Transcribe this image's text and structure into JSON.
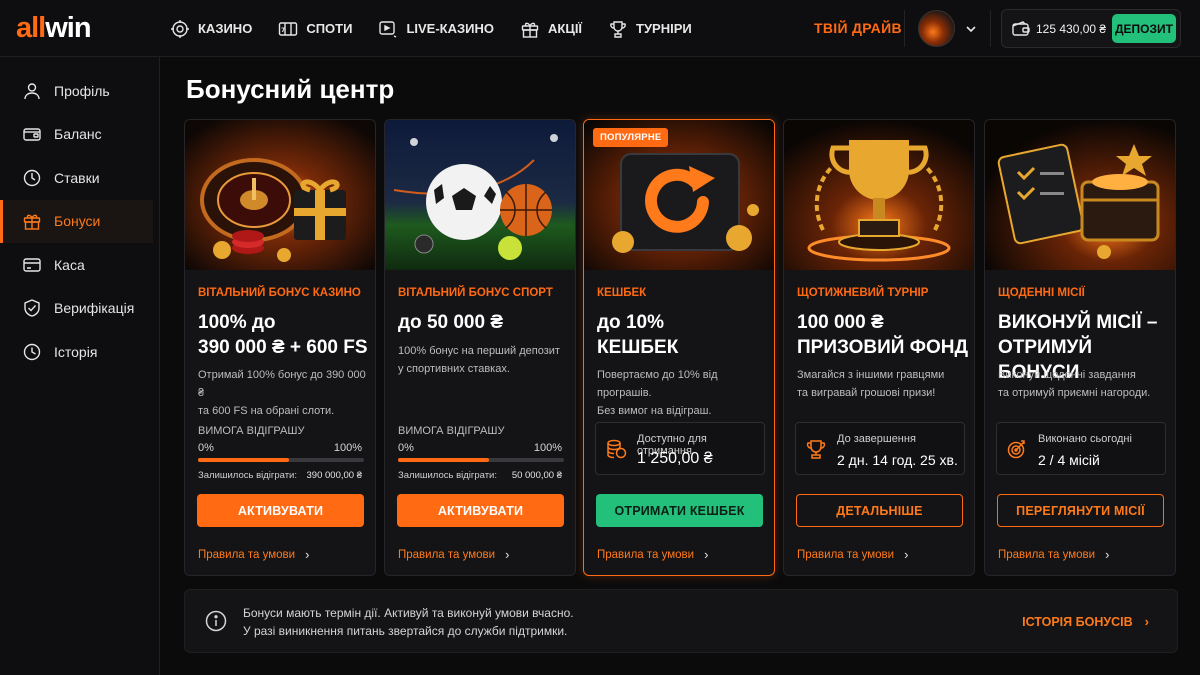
{
  "logo": {
    "part1": "all",
    "part2": "win"
  },
  "nav": [
    {
      "label": "КАЗИНО",
      "icon": "roulette-icon"
    },
    {
      "label": "СПОТИ",
      "icon": "slots-icon"
    },
    {
      "label": "LIVE-КАЗИНО",
      "icon": "live-icon"
    },
    {
      "label": "АКЦІЇ",
      "icon": "gift-icon"
    },
    {
      "label": "ТУРНІРИ",
      "icon": "trophy-icon"
    }
  ],
  "header": {
    "drive_label": "ТВІЙ ДРАЙВ",
    "balance": "125 430,00 ₴",
    "deposit_label": "ДЕПОЗИТ"
  },
  "sidebar": [
    {
      "label": "Профіль",
      "icon": "user-icon",
      "active": false
    },
    {
      "label": "Баланс",
      "icon": "wallet-icon",
      "active": false
    },
    {
      "label": "Ставки",
      "icon": "history-icon",
      "active": false
    },
    {
      "label": "Бонуси",
      "icon": "gift-icon",
      "active": true
    },
    {
      "label": "Каса",
      "icon": "card-icon",
      "active": false
    },
    {
      "label": "Верифікація",
      "icon": "shield-icon",
      "active": false
    },
    {
      "label": "Історія",
      "icon": "clock-icon",
      "active": false
    }
  ],
  "page": {
    "title": "Бонусний центр"
  },
  "cards": [
    {
      "category": "ВІТАЛЬНИЙ БОНУС КАЗИНО",
      "title_line1": "100% до",
      "title_line2": "390 000 ₴ + 600 FS",
      "desc_line1": "Отримай 100% бонус до 390 000 ₴",
      "desc_line2": "та 600 FS на обрані слоти.",
      "req_label": "ВИМОГА ВІДІГРАШУ",
      "req_min": "0%",
      "req_max": "100%",
      "progress": 0.55,
      "remain_label": "Залишилось відіграти:",
      "remain_value": "390 000,00 ₴",
      "button": "АКТИВУВАТИ",
      "rules": "Правила та умови"
    },
    {
      "category": "ВІТАЛЬНИЙ БОНУС СПОРТ",
      "title_line1": "до 50 000 ₴",
      "title_line2": "",
      "desc_line1": "100% бонус на перший депозит",
      "desc_line2": "у спортивних ставках.",
      "req_label": "ВИМОГА ВІДІГРАШУ",
      "req_min": "0%",
      "req_max": "100%",
      "progress": 0.55,
      "remain_label": "Залишилось відіграти:",
      "remain_value": "50 000,00 ₴",
      "button": "АКТИВУВАТИ",
      "rules": "Правила та умови"
    },
    {
      "badge": "ПОПУЛЯРНЕ",
      "category": "КЕШБЕК",
      "title_line1": "до 10%",
      "title_line2": "КЕШБЕК",
      "desc_line1": "Повертаємо до 10% від програшів.",
      "desc_line2": "Без вимог на відіграш.",
      "info_label": "Доступно для отримання",
      "info_value": "1 250,00 ₴",
      "button": "ОТРИМАТИ КЕШБЕК",
      "rules": "Правила та умови"
    },
    {
      "category": "ЩОТИЖНЕВИЙ ТУРНІР",
      "title_line1": "100 000 ₴",
      "title_line2": "ПРИЗОВИЙ ФОНД",
      "desc_line1": "Змагайся з іншими гравцями",
      "desc_line2": "та вигравай грошові призи!",
      "info_label": "До завершення",
      "info_value": "2 дн. 14 год. 25 хв.",
      "button": "ДЕТАЛЬНІШЕ",
      "rules": "Правила та умови"
    },
    {
      "category": "ЩОДЕННІ МІСІЇ",
      "title_line1": "ВИКОНУЙ МІСІЇ –",
      "title_line2": "ОТРИМУЙ БОНУСИ",
      "desc_line1": "Виконуй щоденні завдання",
      "desc_line2": "та отримуй приємні нагороди.",
      "info_label": "Виконано сьогодні",
      "info_value": "2 / 4 місій",
      "button": "ПЕРЕГЛЯНУТИ МІСІЇ",
      "rules": "Правила та умови"
    }
  ],
  "notice": {
    "line1": "Бонуси мають термін дії. Активуй та виконуй умови вчасно.",
    "line2": "У разі виникнення питань звертайся до служби підтримки.",
    "link": "ІСТОРІЯ БОНУСІВ"
  },
  "colors": {
    "accent": "#ff6a13",
    "success": "#22c07a",
    "background": "#0b0b0c",
    "card": "#141416"
  }
}
